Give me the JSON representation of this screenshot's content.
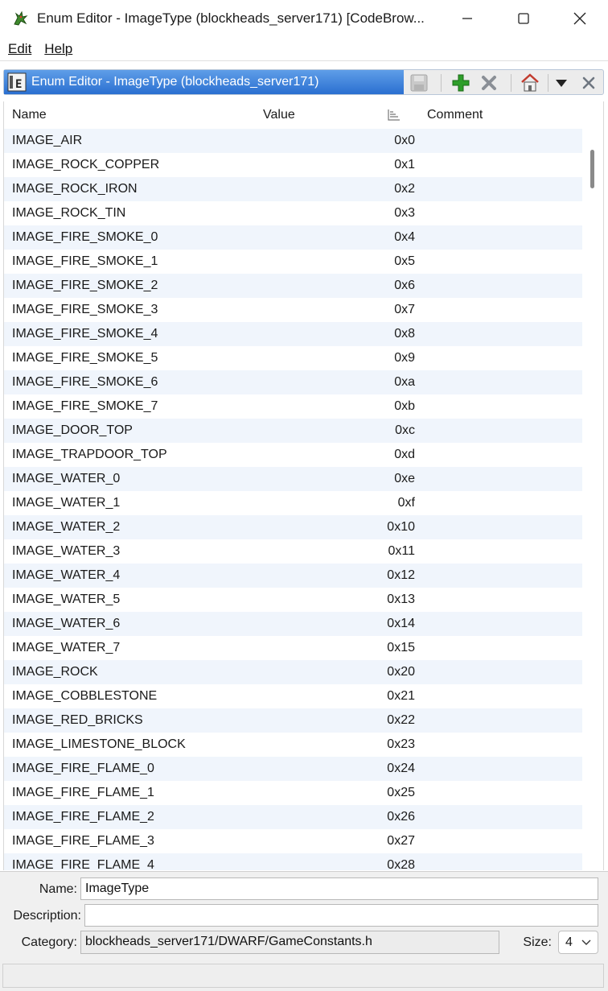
{
  "window": {
    "title": "Enum Editor - ImageType (blockheads_server171) [CodeBrow...",
    "app_icon": "dragon-icon",
    "controls": [
      "minimize-icon",
      "maximize-icon",
      "close-icon"
    ]
  },
  "menubar": {
    "items": [
      {
        "label": "Edit"
      },
      {
        "label": "Help"
      }
    ]
  },
  "panel": {
    "title": "Enum Editor - ImageType (blockheads_server171)",
    "icon": "enum-editor-icon",
    "toolbar": [
      "save-icon",
      "add-icon",
      "delete-icon",
      "home-icon",
      "dropdown-menu-icon",
      "close-panel-icon"
    ]
  },
  "table": {
    "columns": {
      "name": "Name",
      "value": "Value",
      "comment": "Comment"
    },
    "rows": [
      {
        "name": "IMAGE_AIR",
        "value": "0x0"
      },
      {
        "name": "IMAGE_ROCK_COPPER",
        "value": "0x1"
      },
      {
        "name": "IMAGE_ROCK_IRON",
        "value": "0x2"
      },
      {
        "name": "IMAGE_ROCK_TIN",
        "value": "0x3"
      },
      {
        "name": "IMAGE_FIRE_SMOKE_0",
        "value": "0x4"
      },
      {
        "name": "IMAGE_FIRE_SMOKE_1",
        "value": "0x5"
      },
      {
        "name": "IMAGE_FIRE_SMOKE_2",
        "value": "0x6"
      },
      {
        "name": "IMAGE_FIRE_SMOKE_3",
        "value": "0x7"
      },
      {
        "name": "IMAGE_FIRE_SMOKE_4",
        "value": "0x8"
      },
      {
        "name": "IMAGE_FIRE_SMOKE_5",
        "value": "0x9"
      },
      {
        "name": "IMAGE_FIRE_SMOKE_6",
        "value": "0xa"
      },
      {
        "name": "IMAGE_FIRE_SMOKE_7",
        "value": "0xb"
      },
      {
        "name": "IMAGE_DOOR_TOP",
        "value": "0xc"
      },
      {
        "name": "IMAGE_TRAPDOOR_TOP",
        "value": "0xd"
      },
      {
        "name": "IMAGE_WATER_0",
        "value": "0xe"
      },
      {
        "name": "IMAGE_WATER_1",
        "value": "0xf"
      },
      {
        "name": "IMAGE_WATER_2",
        "value": "0x10"
      },
      {
        "name": "IMAGE_WATER_3",
        "value": "0x11"
      },
      {
        "name": "IMAGE_WATER_4",
        "value": "0x12"
      },
      {
        "name": "IMAGE_WATER_5",
        "value": "0x13"
      },
      {
        "name": "IMAGE_WATER_6",
        "value": "0x14"
      },
      {
        "name": "IMAGE_WATER_7",
        "value": "0x15"
      },
      {
        "name": "IMAGE_ROCK",
        "value": "0x20"
      },
      {
        "name": "IMAGE_COBBLESTONE",
        "value": "0x21"
      },
      {
        "name": "IMAGE_RED_BRICKS",
        "value": "0x22"
      },
      {
        "name": "IMAGE_LIMESTONE_BLOCK",
        "value": "0x23"
      },
      {
        "name": "IMAGE_FIRE_FLAME_0",
        "value": "0x24"
      },
      {
        "name": "IMAGE_FIRE_FLAME_1",
        "value": "0x25"
      },
      {
        "name": "IMAGE_FIRE_FLAME_2",
        "value": "0x26"
      },
      {
        "name": "IMAGE_FIRE_FLAME_3",
        "value": "0x27"
      },
      {
        "name": "IMAGE_FIRE_FLAME_4",
        "value": "0x28"
      }
    ]
  },
  "form": {
    "name_label": "Name:",
    "name_value": "ImageType",
    "description_label": "Description:",
    "description_value": "",
    "category_label": "Category:",
    "category_value": "blockheads_server171/DWARF/GameConstants.h",
    "size_label": "Size:",
    "size_value": "4"
  }
}
